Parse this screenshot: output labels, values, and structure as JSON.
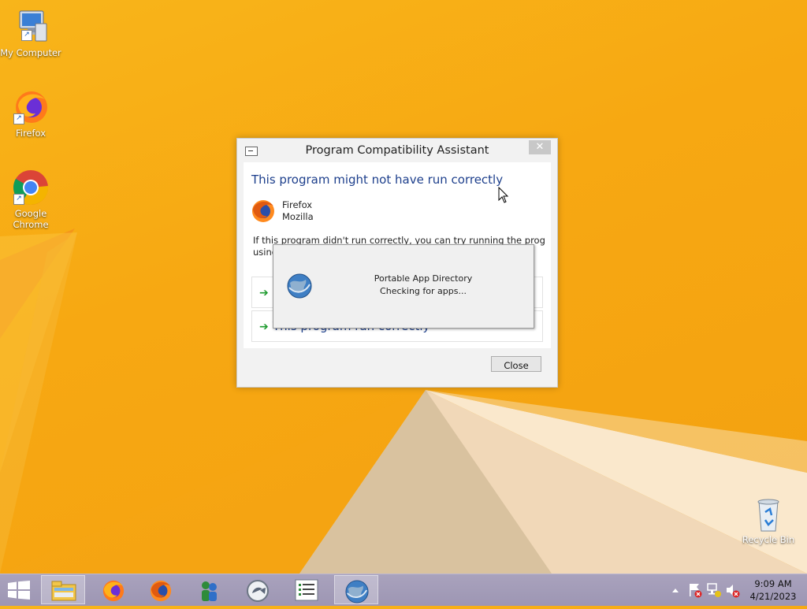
{
  "desktop": {
    "icons": [
      {
        "label": "My Computer",
        "icon": "computer-icon"
      },
      {
        "label": "Firefox",
        "icon": "firefox-icon"
      },
      {
        "label": "Google Chrome",
        "icon": "chrome-icon"
      },
      {
        "label": "Recycle Bin",
        "icon": "recycle-bin-icon"
      }
    ]
  },
  "dialog": {
    "title": "Program Compatibility Assistant",
    "close_glyph": "✕",
    "heading": "This program might not have run correctly",
    "app_name": "Firefox",
    "app_publisher": "Mozilla",
    "message_line1": "If this program didn't run correctly, you can try running the program",
    "message_line2": "using",
    "option2_label": "This program ran correctly",
    "close_button": "Close"
  },
  "splash": {
    "title": "Portable App Directory",
    "status": "Checking for apps..."
  },
  "taskbar": {
    "items": [
      {
        "icon": "start-icon",
        "active": false
      },
      {
        "icon": "file-explorer-icon",
        "active": true
      },
      {
        "icon": "firefox-icon",
        "active": false
      },
      {
        "icon": "firefox-icon",
        "active": false
      },
      {
        "icon": "users-icon",
        "active": false
      },
      {
        "icon": "arrow-circle-icon",
        "active": false
      },
      {
        "icon": "list-icon",
        "active": false
      },
      {
        "icon": "globe-icon",
        "active": true
      }
    ],
    "clock_time": "9:09 AM",
    "clock_date": "4/21/2023"
  },
  "colors": {
    "desktop_bg": "#f7a812",
    "heading_blue": "#1d3f8c",
    "arrow_green": "#1e9b2f",
    "taskbar": "#a29cb8"
  }
}
